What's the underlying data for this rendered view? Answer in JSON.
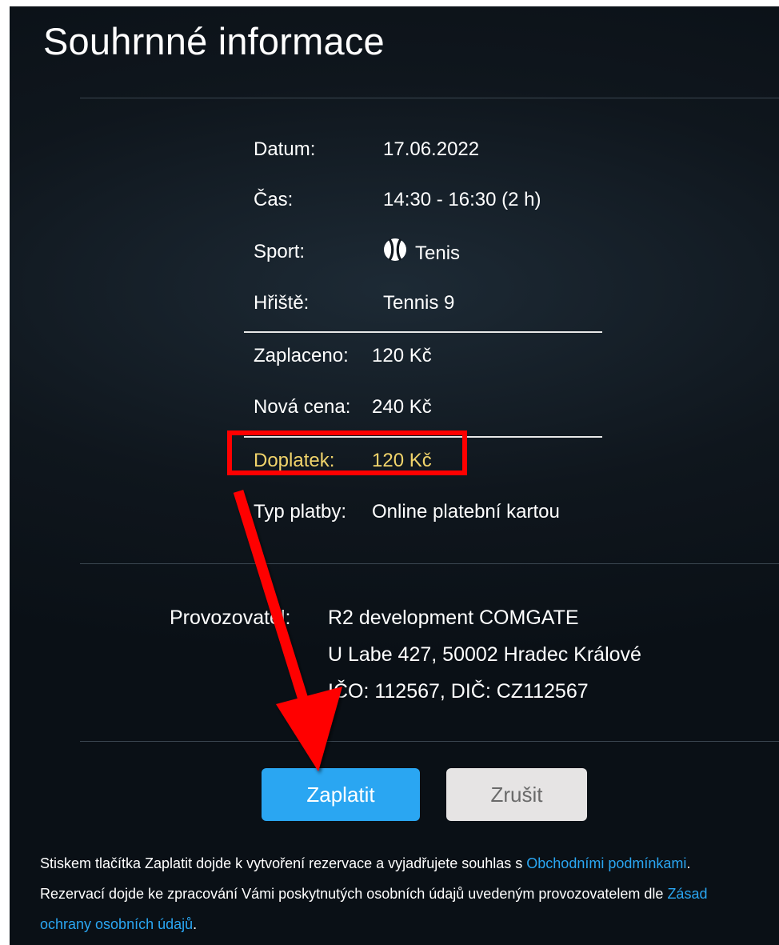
{
  "title": "Souhrnné informace",
  "details": [
    {
      "label": "Datum:",
      "value": "17.06.2022"
    },
    {
      "label": "Čas:",
      "value": "14:30 - 16:30 (2 h)"
    },
    {
      "label": "Sport:",
      "value": "Tenis",
      "icon": "tennis-ball-icon"
    },
    {
      "label": "Hřiště:",
      "value": "Tennis 9"
    }
  ],
  "pricing": [
    {
      "label": "Zaplaceno:",
      "value": "120 Kč"
    },
    {
      "label": "Nová cena:",
      "value": "240 Kč"
    }
  ],
  "surcharge": {
    "label": "Doplatek:",
    "value": "120 Kč"
  },
  "payment_type": {
    "label": "Typ platby:",
    "value": "Online platební kartou"
  },
  "operator": {
    "label": "Provozovatel:",
    "lines": [
      "R2 development COMGATE",
      "U Labe 427, 50002 Hradec Králové",
      "IČO: 112567, DIČ: CZ112567"
    ]
  },
  "buttons": {
    "pay": "Zaplatit",
    "cancel": "Zrušit"
  },
  "footer": {
    "text1": "Stiskem tlačítka Zaplatit dojde k vytvoření rezervace a vyjadřujete souhlas s ",
    "link1": "Obchodními podmínkami",
    "text2": ". Rezervací dojde ke zpracování Vámi poskytnutých osobních údajů uvedeným provozovatelem dle ",
    "link2": "Zásad ochrany osobních údajů",
    "text3": "."
  },
  "colors": {
    "background": "#0f161d",
    "accent": "#2aa6f2",
    "highlight": "#f1d46b",
    "annotation": "#ff0000"
  }
}
